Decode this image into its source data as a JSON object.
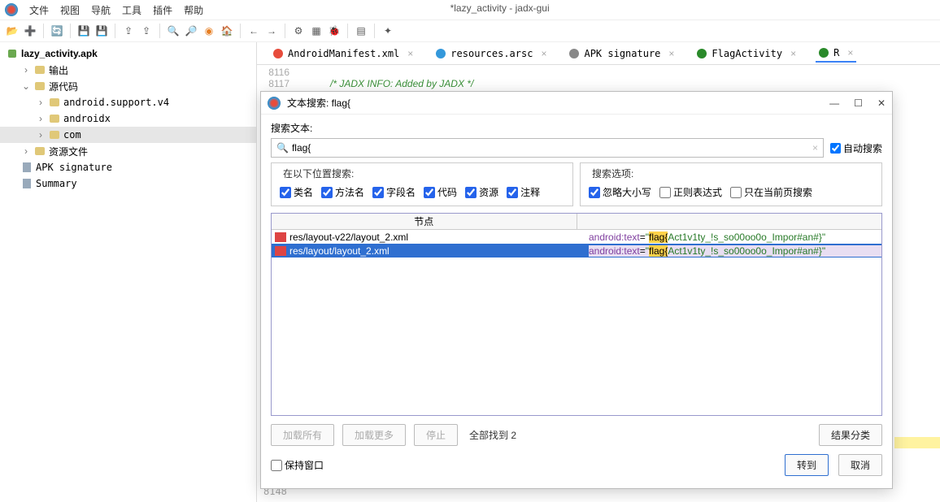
{
  "window_title": "*lazy_activity - jadx-gui",
  "menu": [
    "文件",
    "视图",
    "导航",
    "工具",
    "插件",
    "帮助"
  ],
  "tree": {
    "root": "lazy_activity.apk",
    "n_output": "输出",
    "n_source": "源代码",
    "p1": "android.support.v4",
    "p2": "androidx",
    "p3": "com",
    "n_res": "资源文件",
    "f1": "APK signature",
    "f2": "Summary"
  },
  "tabs": [
    {
      "label": "AndroidManifest.xml"
    },
    {
      "label": "resources.arsc"
    },
    {
      "label": "APK signature"
    },
    {
      "label": "FlagActivity"
    },
    {
      "label": "R",
      "active": true
    }
  ],
  "code": {
    "ln1": "8116",
    "ln2": "8117",
    "comment": "/* JADX INFO: Added by JADX */",
    "ln3": "8148"
  },
  "dialog": {
    "title": "文本搜索: flag{",
    "search_label": "搜索文本:",
    "search_value": "flag{",
    "auto_search": "自动搜索",
    "locations_title": "在以下位置搜索:",
    "options_title": "搜索选项:",
    "cb_class": "类名",
    "cb_method": "方法名",
    "cb_field": "字段名",
    "cb_code": "代码",
    "cb_resource": "资源",
    "cb_comment": "注释",
    "cb_ignorecase": "忽略大小写",
    "cb_regex": "正则表达式",
    "cb_current": "只在当前页搜索",
    "col_node": "节点",
    "r1_path": "res/layout-v22/layout_2.xml",
    "r2_path": "res/layout/layout_2.xml",
    "attr_prefix": "android:text",
    "flag_word": "flag{",
    "flag_rest": "Act1v1ty_!s_so00oo0o_Impor#an#}",
    "load_all": "加载所有",
    "load_more": "加载更多",
    "stop": "停止",
    "found": "全部找到  2",
    "classify": "结果分类",
    "keep": "保持窗口",
    "goto": "转到",
    "cancel": "取消"
  }
}
